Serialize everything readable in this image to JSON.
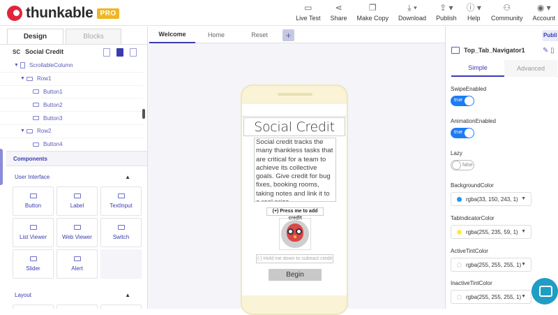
{
  "header": {
    "logo_text": "thunkable",
    "pro_label": "PRO",
    "nav": [
      {
        "label": "Live Test",
        "icon": "phone-icon",
        "glyph": "▭"
      },
      {
        "label": "Share",
        "icon": "share-icon",
        "glyph": "⋖"
      },
      {
        "label": "Make Copy",
        "icon": "copy-icon",
        "glyph": "❐"
      },
      {
        "label": "Download",
        "icon": "download-icon",
        "glyph": "⤓ ▾"
      },
      {
        "label": "Publish",
        "icon": "publish-icon",
        "glyph": "⇪ ▾"
      },
      {
        "label": "Help",
        "icon": "help-icon",
        "glyph": "ⓘ ▾"
      },
      {
        "label": "Community",
        "icon": "community-icon",
        "glyph": "⚇"
      },
      {
        "label": "Account",
        "icon": "account-icon",
        "glyph": "◉ ▾"
      }
    ]
  },
  "left": {
    "tabs": {
      "design": "Design",
      "blocks": "Blocks"
    },
    "project_abbr": "SC",
    "project_name": "Social Credit",
    "tree": [
      {
        "label": "ScrollableColumn",
        "indent": 1,
        "expanded": true,
        "kind": "column"
      },
      {
        "label": "Row1",
        "indent": 2,
        "expanded": true,
        "kind": "row"
      },
      {
        "label": "Button1",
        "indent": 3,
        "kind": "button"
      },
      {
        "label": "Button2",
        "indent": 3,
        "kind": "button"
      },
      {
        "label": "Button3",
        "indent": 3,
        "kind": "button"
      },
      {
        "label": "Row2",
        "indent": 2,
        "expanded": true,
        "kind": "row"
      },
      {
        "label": "Button4",
        "indent": 3,
        "kind": "button"
      }
    ],
    "components_label": "Components",
    "sections": [
      {
        "title": "User Interface",
        "items": [
          "Button",
          "Label",
          "TextInput",
          "List Viewer",
          "Web Viewer",
          "Switch",
          "Slider",
          "Alert"
        ]
      },
      {
        "title": "Layout",
        "items": []
      }
    ]
  },
  "center": {
    "tabs": [
      "Welcome",
      "Home",
      "Reset"
    ],
    "add_label": "+",
    "app": {
      "title": "Social Credit",
      "description": "Social credit tracks the many thankless tasks that are critical for a team to achieve its collective goals. Give credit for bug fixes, booking rooms, taking notes and link it to a real prize.",
      "add_credit_label": "(+) Press me to add credit",
      "subtract_label": "(-) Hold me down to subtract credit",
      "begin_label": "Begin"
    }
  },
  "right": {
    "publish_label": "Publi",
    "component_name": "Top_Tab_Navigator1",
    "tabs": {
      "simple": "Simple",
      "advanced": "Advanced"
    },
    "properties": [
      {
        "label": "SwipeEnabled",
        "type": "toggle",
        "value": "true"
      },
      {
        "label": "AnimationEnabled",
        "type": "toggle",
        "value": "true"
      },
      {
        "label": "Lazy",
        "type": "toggle",
        "value": "false"
      },
      {
        "label": "BackgroundColor",
        "type": "color",
        "value": "rgba(33, 150, 243, 1)",
        "swatch": "#2196f3"
      },
      {
        "label": "TabIndicatorColor",
        "type": "color",
        "value": "rgba(255, 235, 59, 1)",
        "swatch": "#ffeb3b"
      },
      {
        "label": "ActiveTintColor",
        "type": "color",
        "value": "rgba(255, 255, 255, 1)",
        "swatch": "#ffffff"
      },
      {
        "label": "InactiveTintColor",
        "type": "color",
        "value": "rgba(255, 255, 255, 1)",
        "swatch": "#ffffff"
      }
    ]
  },
  "colors": {
    "accent": "#3a3bb0",
    "toggle_on": "#1e7cf2",
    "brand_pro": "#f0b623",
    "chat": "#1f9dc4"
  }
}
